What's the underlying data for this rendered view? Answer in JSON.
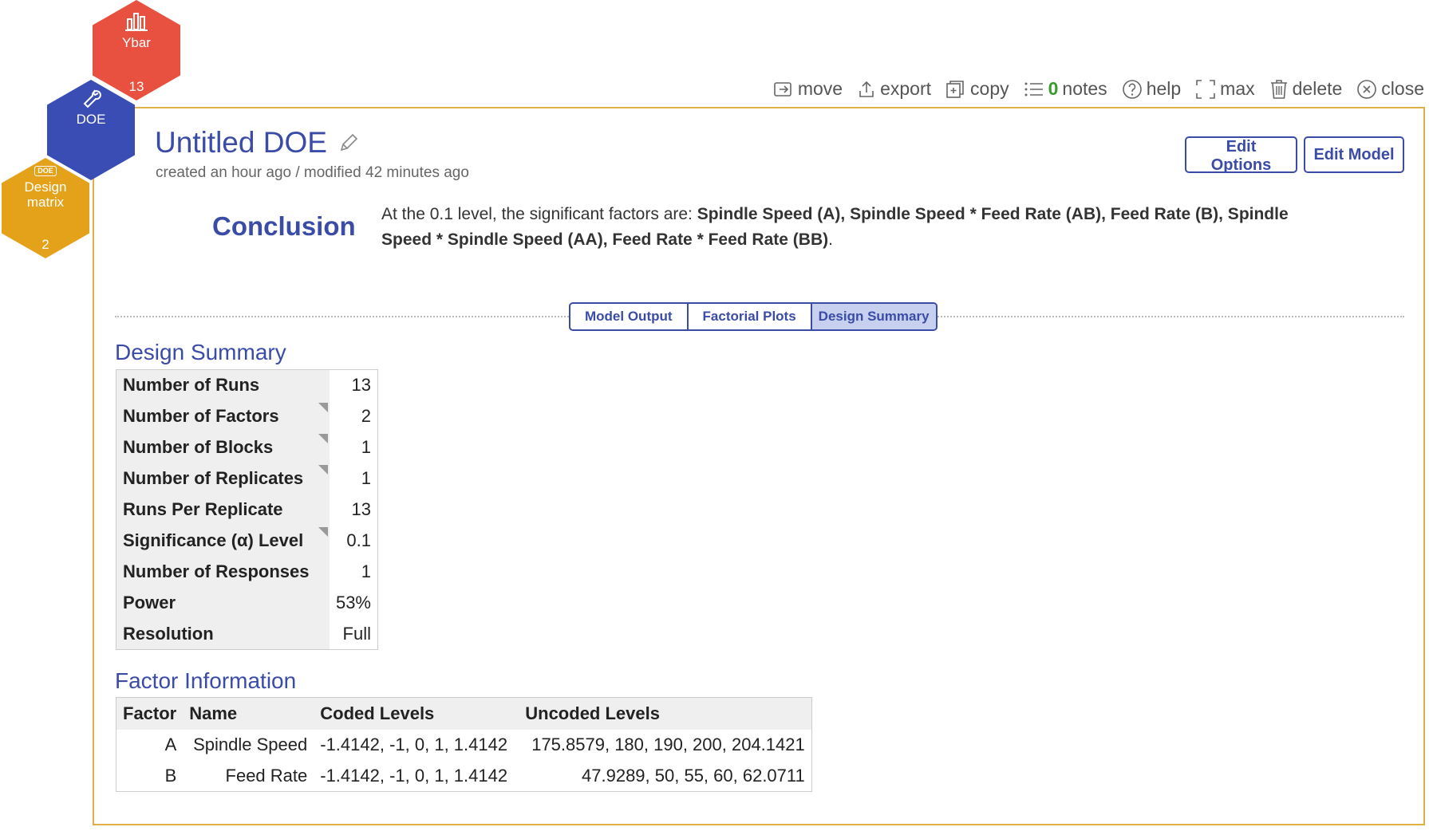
{
  "toolbar": {
    "move": "move",
    "export": "export",
    "copy": "copy",
    "notes_count": "0",
    "notes": "notes",
    "help": "help",
    "max": "max",
    "delete": "delete",
    "close": "close"
  },
  "hexagons": {
    "ybar": {
      "label": "Ybar",
      "count": "13",
      "color": "#e8513f",
      "icon": "bar-chart-icon"
    },
    "doe": {
      "label": "DOE",
      "color": "#3a4db4",
      "icon": "wrench-icon"
    },
    "design_matrix": {
      "label_line1": "Design",
      "label_line2": "matrix",
      "count": "2",
      "badge": "DOE",
      "color": "#e3a21a"
    }
  },
  "header": {
    "title": "Untitled DOE",
    "subtitle": "created an hour ago / modified 42 minutes ago",
    "edit_options": "Edit Options",
    "edit_model": "Edit Model"
  },
  "conclusion": {
    "label": "Conclusion",
    "prefix": "At the 0.1 level, the significant factors are: ",
    "factors": "Spindle Speed (A), Spindle Speed * Feed Rate (AB), Feed Rate (B), Spindle Speed * Spindle Speed (AA), Feed Rate * Feed Rate (BB)",
    "suffix": "."
  },
  "tabs": [
    {
      "label": "Model Output"
    },
    {
      "label": "Factorial Plots"
    },
    {
      "label": "Design Summary"
    }
  ],
  "design_summary": {
    "title": "Design Summary",
    "rows": [
      {
        "label": "Number of Runs",
        "value": "13"
      },
      {
        "label": "Number of Factors",
        "value": "2"
      },
      {
        "label": "Number of Blocks",
        "value": "1"
      },
      {
        "label": "Number of Replicates",
        "value": "1"
      },
      {
        "label": "Runs Per Replicate",
        "value": "13"
      },
      {
        "label": "Significance (α) Level",
        "value": "0.1"
      },
      {
        "label": "Number of Responses",
        "value": "1"
      },
      {
        "label": "Power",
        "value": "53%"
      },
      {
        "label": "Resolution",
        "value": "Full"
      }
    ]
  },
  "factor_information": {
    "title": "Factor Information",
    "headers": [
      "Factor",
      "Name",
      "Coded Levels",
      "Uncoded Levels"
    ],
    "rows": [
      [
        "A",
        "Spindle Speed",
        "-1.4142, -1, 0, 1, 1.4142",
        "175.8579, 180, 190, 200, 204.1421"
      ],
      [
        "B",
        "Feed Rate",
        "-1.4142, -1, 0, 1, 1.4142",
        "47.9289, 50, 55, 60, 62.0711"
      ]
    ]
  },
  "colors": {
    "accent": "#3a4ca6",
    "panel_border": "#e0b048",
    "notes_count": "#3a9a2e"
  }
}
